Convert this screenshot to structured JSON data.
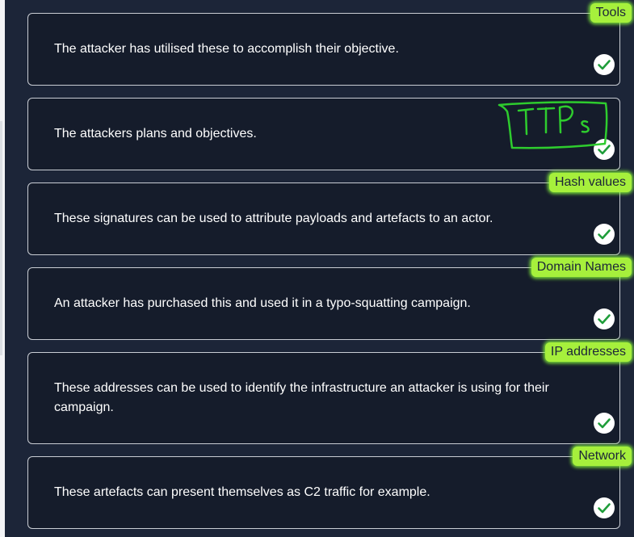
{
  "cards": [
    {
      "text": "The attacker has utilised these to accomplish their objective.",
      "answer": "Tools"
    },
    {
      "text": "The attackers plans and objectives.",
      "answer": "TTPs"
    },
    {
      "text": "These signatures can be used to attribute payloads and artefacts to an actor.",
      "answer": "Hash values"
    },
    {
      "text": "An attacker has purchased this and used it in a typo-squatting campaign.",
      "answer": "Domain Names"
    },
    {
      "text": "These addresses can be used to identify the infrastructure an attacker is using for their campaign.",
      "answer": "IP addresses"
    },
    {
      "text": "These artefacts can present themselves as C2 traffic for example.",
      "answer": "Network"
    }
  ],
  "icons": {
    "check": "check-circle-icon"
  },
  "colors": {
    "background": "#1c2538",
    "card": "#151c2b",
    "accent": "#a6f03c",
    "check": "#1f9d3a"
  }
}
